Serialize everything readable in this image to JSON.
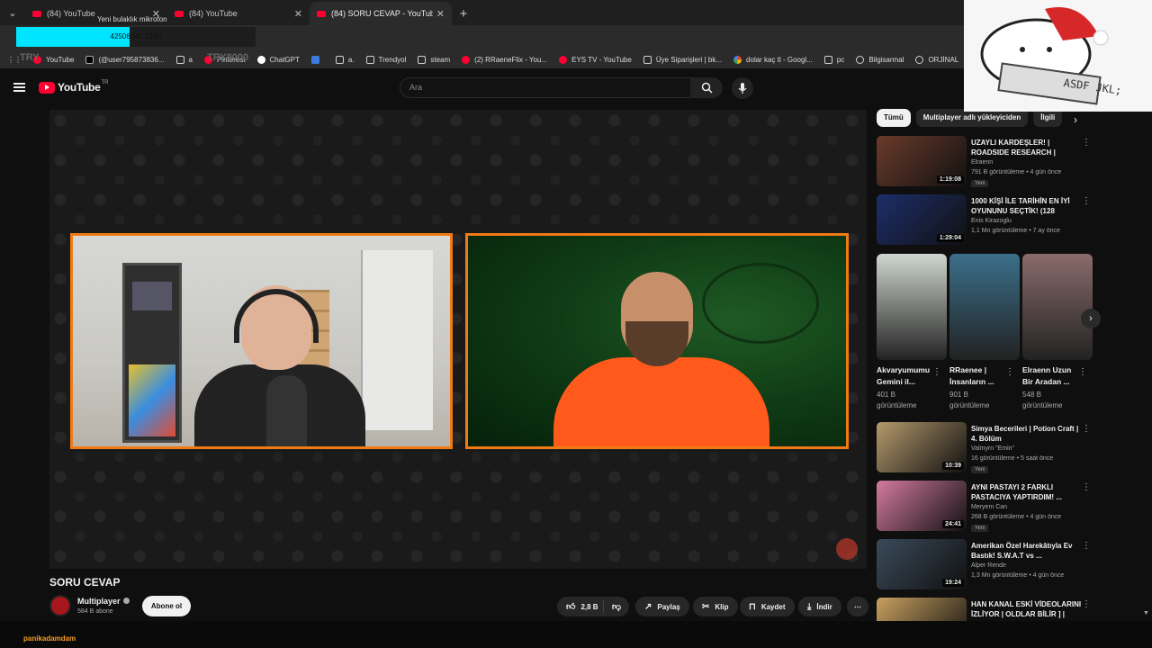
{
  "browser": {
    "tabs": [
      {
        "title": "(84) YouTube",
        "active": false
      },
      {
        "title": "(84) YouTube",
        "active": false
      },
      {
        "title": "(84) SORU CEVAP - YouTube",
        "active": true
      }
    ],
    "bookmarks": [
      {
        "label": "YouTube",
        "icon": "youtube-icon"
      },
      {
        "label": "(@user795873836...",
        "icon": "tiktok-icon"
      },
      {
        "label": "a",
        "icon": "folder-icon"
      },
      {
        "label": "Pinterest",
        "icon": "pinterest-icon"
      },
      {
        "label": "ChatGPT",
        "icon": "chatgpt-icon"
      },
      {
        "label": "",
        "icon": "feather-icon"
      },
      {
        "label": "a.",
        "icon": "folder-icon"
      },
      {
        "label": "Trendyol",
        "icon": "folder-icon"
      },
      {
        "label": "steam",
        "icon": "folder-icon"
      },
      {
        "label": "(2) RRaeneFlix - You...",
        "icon": "youtube-icon"
      },
      {
        "label": "EYS TV - YouTube",
        "icon": "youtube-icon"
      },
      {
        "label": "Üye Siparişleri | bk...",
        "icon": "folder-icon"
      },
      {
        "label": "dolar kaç tl - Googl...",
        "icon": "google-icon"
      },
      {
        "label": "pc",
        "icon": "folder-icon"
      },
      {
        "label": "Bilgisarmal",
        "icon": "globe-icon"
      },
      {
        "label": "ORJİNAL",
        "icon": "globe-icon"
      }
    ]
  },
  "overlay": {
    "label": "Yeni bulaklık mikrofon",
    "progress_text": "42506 (47.22%)",
    "progress_fraction": 0.4722,
    "try_left": "TRY",
    "try_right": "TRY9000",
    "accent": "#00e5ff"
  },
  "youtube": {
    "logo_text": "YouTube",
    "region": "TR",
    "search_placeholder": "Ara"
  },
  "video": {
    "title": "SORU CEVAP",
    "channel": "Multiplayer",
    "subscribers": "584 B abone",
    "subscribe_label": "Abone ol",
    "likes": "2,8 B",
    "share_label": "Paylaş",
    "clip_label": "Klip",
    "save_label": "Kaydet",
    "download_label": "İndir",
    "frame_color": "#f07a14"
  },
  "sidebar": {
    "chips": [
      "Tümü",
      "Multiplayer adlı yükleyiciden",
      "İlgili"
    ],
    "recs_top": [
      {
        "title": "UZAYLI KARDEŞLER! | ROADSIDE RESEARCH | BÖLÜ...",
        "channel": "Elraenn",
        "meta": "791 B görüntüleme • 4 gün önce",
        "badge": "Yeni",
        "duration": "1:19:08",
        "thumb": "#6a3a2a"
      },
      {
        "title": "1000 KİŞİ İLE TARİHİN EN İYİ OYUNUNU SEÇTİK! (128 OYUN...",
        "channel": "Enis Kirazoglu",
        "meta": "1,1 Mn görüntüleme • 7 ay önce",
        "badge": "",
        "duration": "1:29:04",
        "thumb": "#1c2e6a"
      }
    ],
    "shorts": [
      {
        "title": "Akvaryumumu Gemini il...",
        "views": "401 B görüntüleme",
        "thumb": "#cfd6cf"
      },
      {
        "title": "RRaenee | İnsanların ...",
        "views": "901 B görüntüleme",
        "thumb": "#3b6f8a"
      },
      {
        "title": "Elraenn Uzun Bir Aradan ...",
        "views": "548 B görüntüleme",
        "thumb": "#8a6b6b"
      }
    ],
    "recs_bottom": [
      {
        "title": "Simya Becerileri | Potion Craft | 4. Bölüm",
        "channel": "Valmyrn \"Emin\"",
        "meta": "16 görüntüleme • 5 saat önce",
        "badge": "Yeni",
        "duration": "10:39",
        "thumb": "#b59a6b"
      },
      {
        "title": "AYNI PASTAYI 2 FARKLI PASTACIYA YAPTIRDIM! ...",
        "channel": "Meryem Can",
        "meta": "268 B görüntüleme • 4 gün önce",
        "badge": "Yeni",
        "duration": "24:41",
        "thumb": "#d47aa0"
      },
      {
        "title": "Amerikan Özel Harekâtıyla Ev Bastık! S.W.A.T vs ...",
        "channel": "Alper Rende",
        "meta": "1,3 Mn görüntüleme • 4 gün önce",
        "badge": "",
        "duration": "19:24",
        "thumb": "#3a4a5a"
      },
      {
        "title": "HAN KANAL ESKİ VİDEOLARINI İZLİYOR | OLDLAR BİLİR ] | HA...",
        "channel": "",
        "meta": "",
        "badge": "",
        "duration": "",
        "thumb": "#c8a060"
      }
    ]
  },
  "chat": {
    "username": "panikadamdam"
  }
}
